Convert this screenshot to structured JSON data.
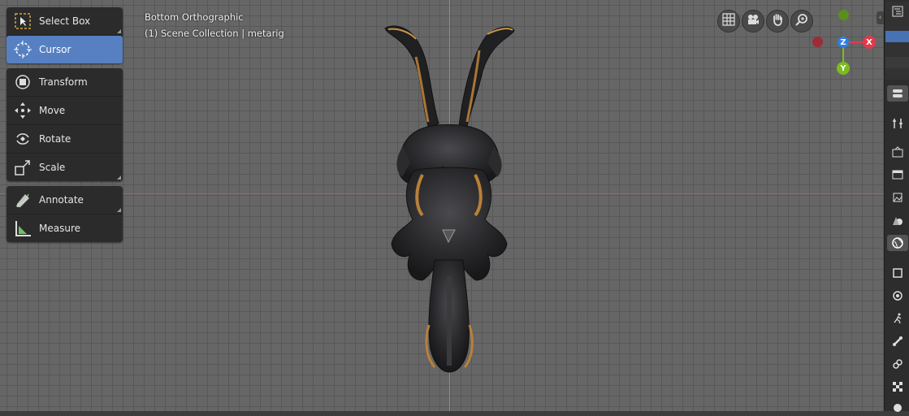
{
  "viewport": {
    "view_name": "Bottom Orthographic",
    "collection_info": "(1) Scene Collection | metarig"
  },
  "toolbar": {
    "select_box": "Select Box",
    "cursor": "Cursor",
    "transform": "Transform",
    "move": "Move",
    "rotate": "Rotate",
    "scale": "Scale",
    "annotate": "Annotate",
    "measure": "Measure",
    "active_tool": "Cursor"
  },
  "navigation": {
    "icons": [
      "grid-icon",
      "camera-icon",
      "hand-icon",
      "zoom-icon"
    ]
  },
  "gizmo": {
    "z_label": "Z",
    "x_label": "X",
    "y_label": "Y",
    "colors": {
      "x": "#e3394c",
      "y": "#7cbb1e",
      "z": "#2f7de1"
    }
  },
  "properties_tabs": [
    "tool",
    "render",
    "output",
    "view-layer",
    "scene",
    "world",
    "object",
    "modifiers",
    "particles",
    "physics",
    "constraints",
    "data",
    "material"
  ],
  "colors": {
    "accent": "#5680c2",
    "axis_x": "#c8575f",
    "axis_y": "#7bb33a"
  }
}
